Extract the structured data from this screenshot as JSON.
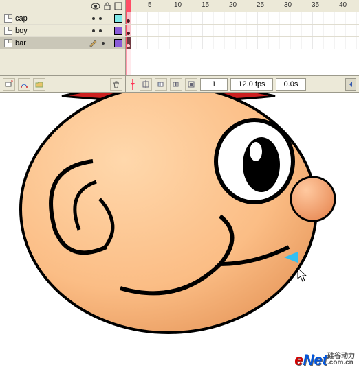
{
  "timeline": {
    "ruler_marks": [
      "5",
      "10",
      "15",
      "20",
      "25",
      "30",
      "35",
      "40"
    ],
    "playhead_frame": 1
  },
  "layers": [
    {
      "name": "cap",
      "selected": false,
      "locked": false,
      "color": "#7fe8e8",
      "keyframe": true
    },
    {
      "name": "boy",
      "selected": false,
      "locked": false,
      "color": "#8a5bd8",
      "keyframe": true
    },
    {
      "name": "bar",
      "selected": true,
      "locked": true,
      "color": "#8a5bd8",
      "keyframe": true
    }
  ],
  "status": {
    "current_frame": "1",
    "fps": "12.0 fps",
    "time": "0.0s"
  },
  "stage": {
    "watermark_e": "e",
    "watermark_net": "Net",
    "watermark_cn_top": "硅谷动力",
    "watermark_cn_bot": ".com.cn"
  },
  "icons": {
    "eye": "eye-icon",
    "lock": "lock-icon",
    "outline": "outline-icon",
    "playhead": "playhead-icon",
    "trash": "trash-icon",
    "insert": "insert-layer-icon",
    "folder": "add-folder-icon",
    "guide": "add-guide-icon",
    "onion": "onion-skin-icon",
    "center": "center-frame-icon",
    "loop": "loop-icon",
    "scroll_left": "scroll-left-icon"
  }
}
